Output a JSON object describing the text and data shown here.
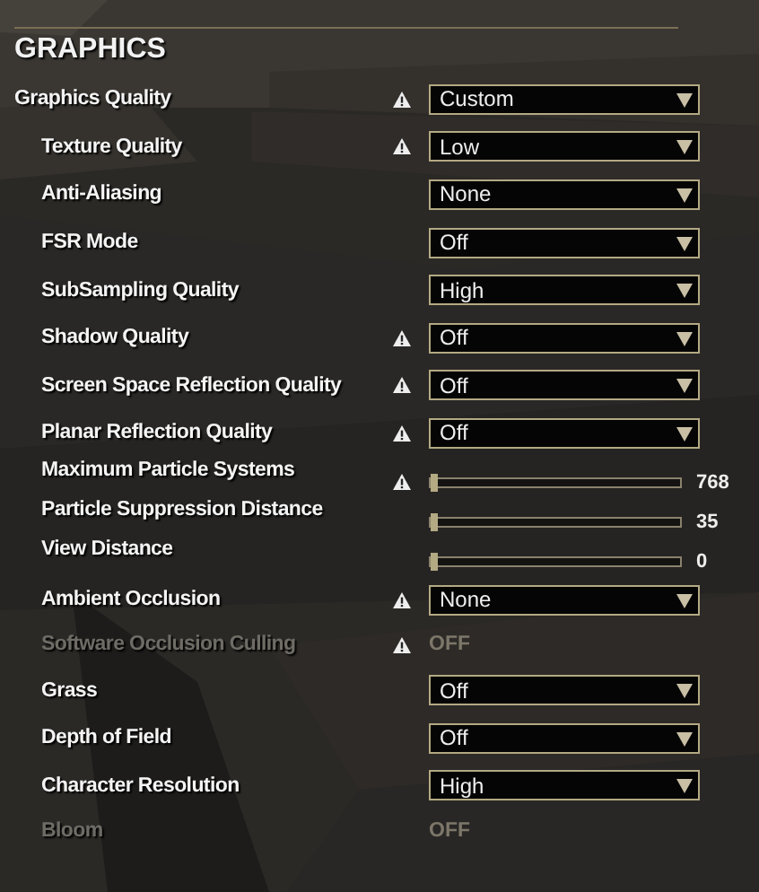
{
  "title": "GRAPHICS",
  "settings": [
    {
      "label": "Graphics Quality",
      "kind": "dropdown",
      "warning": true,
      "disabled": false,
      "value": "Custom",
      "children": [
        {
          "label": "Texture Quality",
          "kind": "dropdown",
          "warning": true,
          "disabled": false,
          "value": "Low"
        },
        {
          "label": "Anti-Aliasing",
          "kind": "dropdown",
          "warning": false,
          "disabled": false,
          "value": "None"
        },
        {
          "label": "FSR Mode",
          "kind": "dropdown",
          "warning": false,
          "disabled": false,
          "value": "Off"
        },
        {
          "label": "SubSampling Quality",
          "kind": "dropdown",
          "warning": false,
          "disabled": false,
          "value": "High"
        },
        {
          "label": "Shadow Quality",
          "kind": "dropdown",
          "warning": true,
          "disabled": false,
          "value": "Off"
        },
        {
          "label": "Screen Space Reflection Quality",
          "kind": "dropdown",
          "warning": true,
          "disabled": false,
          "value": "Off"
        },
        {
          "label": "Planar Reflection Quality",
          "kind": "dropdown",
          "warning": true,
          "disabled": false,
          "value": "Off"
        },
        {
          "label": "Maximum Particle Systems",
          "kind": "slider",
          "warning": true,
          "disabled": false,
          "level": 0,
          "value": "768"
        },
        {
          "label": "Particle Suppression Distance",
          "kind": "slider",
          "warning": false,
          "disabled": false,
          "level": 0,
          "value": "35"
        },
        {
          "label": "View Distance",
          "kind": "slider",
          "warning": false,
          "disabled": false,
          "level": 0,
          "value": "0"
        },
        {
          "label": "Ambient Occlusion",
          "kind": "dropdown",
          "warning": true,
          "disabled": false,
          "value": "None"
        },
        {
          "label": "Software Occlusion Culling",
          "kind": "toggle",
          "warning": true,
          "disabled": true,
          "value": "OFF"
        },
        {
          "label": "Grass",
          "kind": "dropdown",
          "warning": false,
          "disabled": false,
          "value": "Off"
        },
        {
          "label": "Depth of Field",
          "kind": "dropdown",
          "warning": false,
          "disabled": false,
          "value": "Off"
        },
        {
          "label": "Character Resolution",
          "kind": "dropdown",
          "warning": false,
          "disabled": false,
          "value": "High"
        },
        {
          "label": "Bloom",
          "kind": "toggle",
          "warning": false,
          "disabled": true,
          "value": "OFF"
        }
      ]
    }
  ]
}
